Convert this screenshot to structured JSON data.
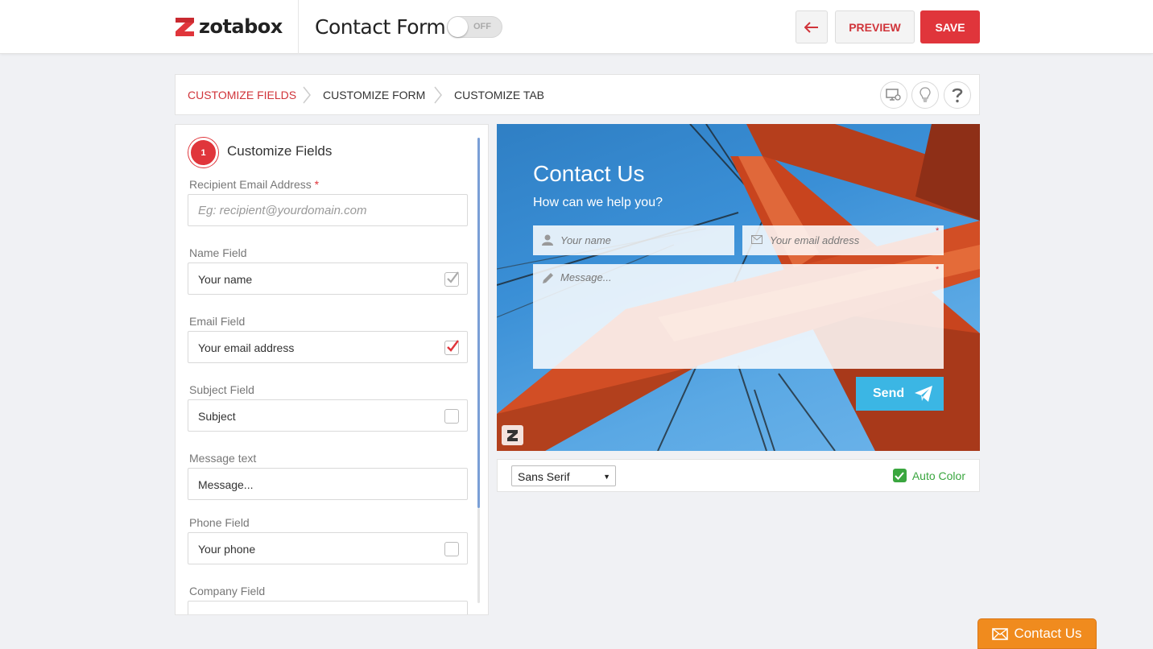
{
  "header": {
    "logo_text": "zotabox",
    "page_title": "Contact Form",
    "toggle_label": "OFF",
    "toggle_state": "off",
    "back_icon": "arrow-left-icon",
    "preview_label": "PREVIEW",
    "save_label": "SAVE",
    "brand_color": "#e0353b"
  },
  "steps": {
    "items": [
      {
        "label": "CUSTOMIZE FIELDS",
        "active": true
      },
      {
        "label": "CUSTOMIZE FORM",
        "active": false
      },
      {
        "label": "CUSTOMIZE TAB",
        "active": false
      }
    ],
    "icons": [
      "desktop-settings-icon",
      "lightbulb-icon",
      "help-icon"
    ]
  },
  "panel": {
    "step_number": "1",
    "title": "Customize Fields",
    "fields": [
      {
        "label": "Recipient Email Address",
        "required": "*",
        "placeholder": "Eg: recipient@yourdomain.com",
        "value": ""
      },
      {
        "label": "Name Field",
        "value": "Your name",
        "checked": "grey"
      },
      {
        "label": "Email Field",
        "value": "Your email address",
        "checked": "red"
      },
      {
        "label": "Subject Field",
        "value": "Subject",
        "checked": "none"
      },
      {
        "label": "Message text",
        "value": "Message..."
      },
      {
        "label": "Phone Field",
        "value": "Your phone",
        "checked": "none"
      },
      {
        "label": "Company Field",
        "value": ""
      }
    ]
  },
  "preview": {
    "title": "Contact Us",
    "subtitle": "How can we help you?",
    "name_placeholder": "Your name",
    "email_placeholder": "Your email address",
    "message_placeholder": "Message...",
    "required_mark": "*",
    "send_label": "Send",
    "accent_color": "#3bb6e4"
  },
  "options": {
    "font_value": "Sans Serif",
    "auto_color_label": "Auto Color",
    "auto_color_checked": true
  },
  "floating_tab": {
    "label": "Contact Us",
    "color": "#f08b1e"
  }
}
